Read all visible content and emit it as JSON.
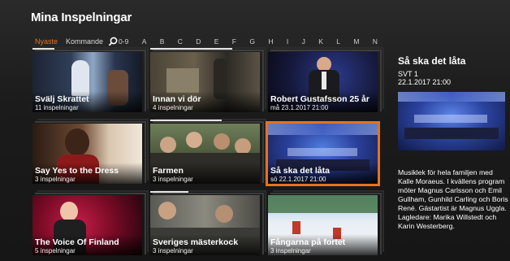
{
  "page_title": "Mina Inspelningar",
  "nav": {
    "tabs": [
      "Nyaste",
      "Kommande"
    ],
    "search_icon": "search-icon",
    "letters": [
      "0-9",
      "A",
      "B",
      "C",
      "D",
      "E",
      "F",
      "G",
      "H",
      "I",
      "J",
      "K",
      "L",
      "M",
      "N"
    ]
  },
  "tiles": [
    {
      "title": "Svälj Skrattet",
      "sub": "11 inspelningar",
      "progress": 0.2
    },
    {
      "title": "Innan vi dör",
      "sub": "4 inspelningar",
      "progress": 0.75
    },
    {
      "title": "Robert Gustafsson 25 år",
      "sub": "må 23.1.2017 21:00",
      "progress": 0
    },
    {
      "title": "Say Yes to the Dress",
      "sub": "3 inspelningar",
      "progress": 0
    },
    {
      "title": "Farmen",
      "sub": "3 inspelningar",
      "progress": 0.65
    },
    {
      "title": "Så ska det låta",
      "sub": "sö 22.1.2017 21:00",
      "progress": 0
    },
    {
      "title": "The Voice Of Finland",
      "sub": "5 inspelningar",
      "progress": 0
    },
    {
      "title": "Sveriges mästerkock",
      "sub": "3 inspelningar",
      "progress": 0.35
    },
    {
      "title": "Fångarna på fortet",
      "sub": "3 inspelningar",
      "progress": 0
    }
  ],
  "detail": {
    "title": "Så ska det låta",
    "channel": "SVT 1",
    "date": "22.1.2017 21:00",
    "description": "Musiklek för hela familjen med Kalle Moraeus. I kvällens program möter Magnus Carlsson och Emil Gullham, Gunhild Carling och Boris René. Gästartist är Magnus Uggla. Lagledare: Marika Willstedt och Karin Westerberg."
  },
  "colors": {
    "accent": "#e8711c",
    "background": "#141414"
  }
}
